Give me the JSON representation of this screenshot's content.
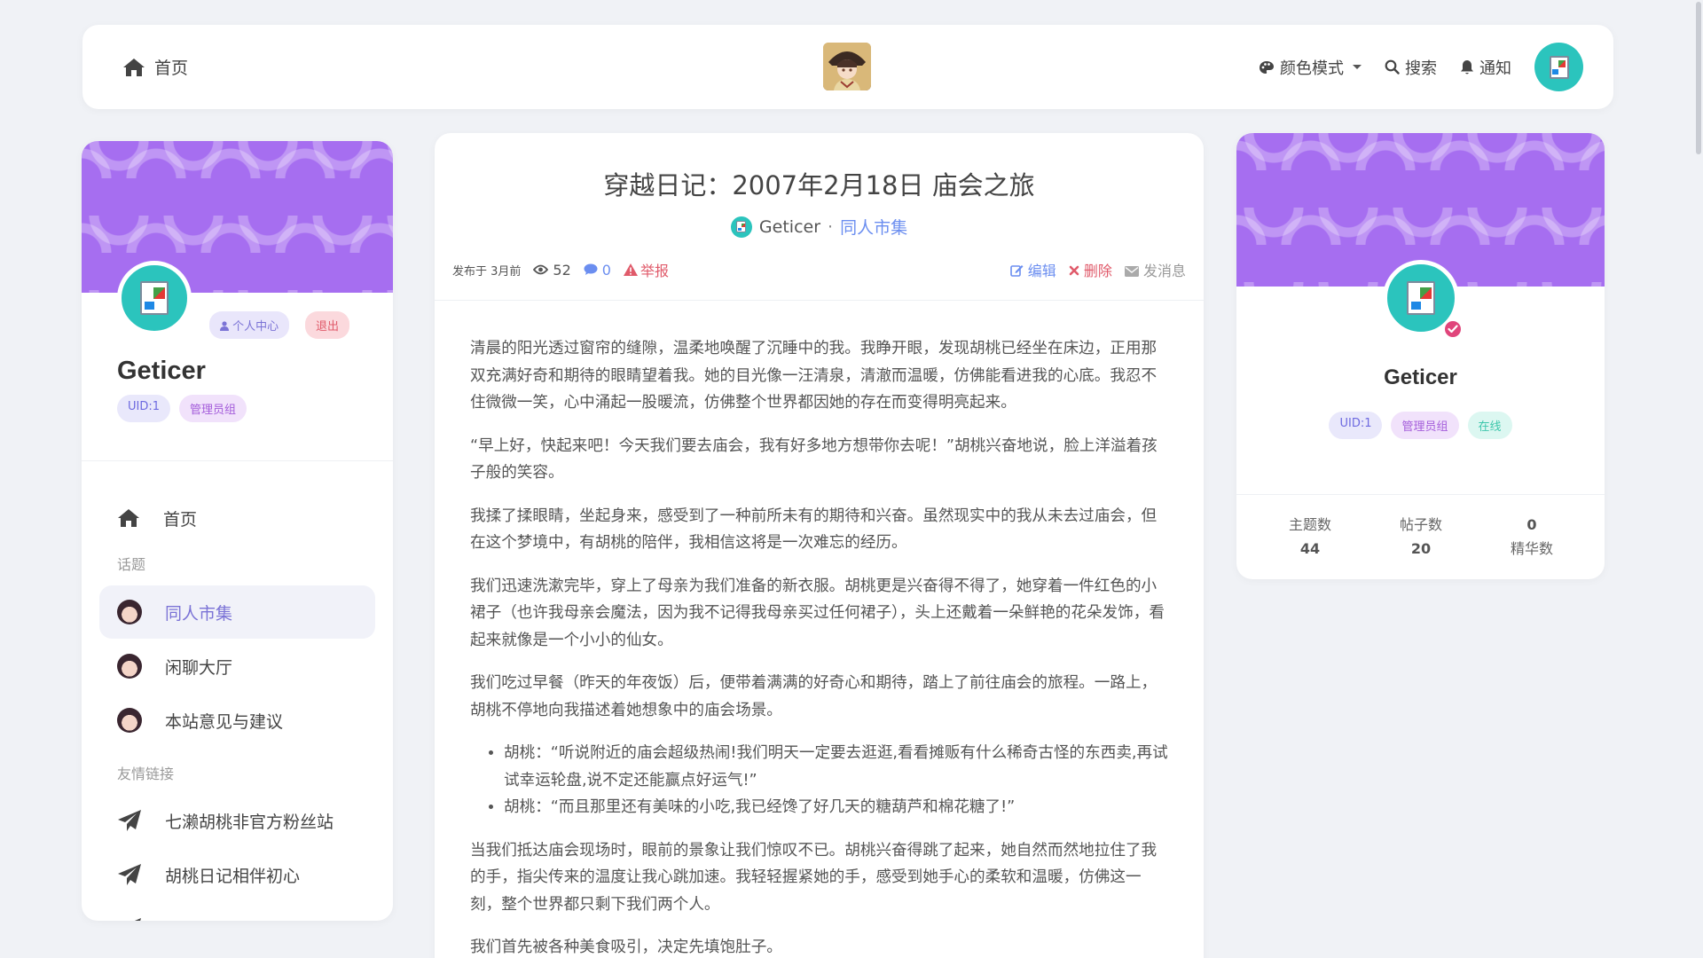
{
  "navbar": {
    "home_label": "首页",
    "color_mode_label": "颜色模式",
    "search_label": "搜索",
    "notify_label": "通知"
  },
  "sidebar": {
    "username": "Geticer",
    "profile_button": "个人中心",
    "logout_button": "退出",
    "uid_tag": "UID:1",
    "role_tag": "管理员组",
    "home_label": "首页",
    "section_topics": "话题",
    "topics": [
      {
        "label": "同人市集",
        "active": true
      },
      {
        "label": "闲聊大厅",
        "active": false
      },
      {
        "label": "本站意见与建议",
        "active": false
      }
    ],
    "section_links": "友情链接",
    "links": [
      {
        "label": "七濑胡桃非官方粉丝站"
      },
      {
        "label": "胡桃日记相伴初心"
      }
    ]
  },
  "post": {
    "title": "穿越日记：2007年2月18日 庙会之旅",
    "author": "Geticer",
    "separator": "·",
    "category": "同人市集",
    "published": "发布于 3月前",
    "views": "52",
    "comments": "0",
    "report": "举报",
    "edit": "编辑",
    "delete": "删除",
    "message": "发消息",
    "paragraphs": [
      "清晨的阳光透过窗帘的缝隙，温柔地唤醒了沉睡中的我。我睁开眼，发现胡桃已经坐在床边，正用那双充满好奇和期待的眼睛望着我。她的目光像一汪清泉，清澈而温暖，仿佛能看进我的心底。我忍不住微微一笑，心中涌起一股暖流，仿佛整个世界都因她的存在而变得明亮起来。",
      "“早上好，快起来吧！今天我们要去庙会，我有好多地方想带你去呢！”胡桃兴奋地说，脸上洋溢着孩子般的笑容。",
      "我揉了揉眼睛，坐起身来，感受到了一种前所未有的期待和兴奋。虽然现实中的我从未去过庙会，但在这个梦境中，有胡桃的陪伴，我相信这将是一次难忘的经历。",
      "我们迅速洗漱完毕，穿上了母亲为我们准备的新衣服。胡桃更是兴奋得不得了，她穿着一件红色的小裙子（也许我母亲会魔法，因为我不记得我母亲买过任何裙子），头上还戴着一朵鲜艳的花朵发饰，看起来就像是一个小小的仙女。",
      "我们吃过早餐（昨天的年夜饭）后，便带着满满的好奇心和期待，踏上了前往庙会的旅程。一路上，胡桃不停地向我描述着她想象中的庙会场景。"
    ],
    "bullets": [
      "胡桃：“听说附近的庙会超级热闹!我们明天一定要去逛逛,看看摊贩有什么稀奇古怪的东西卖,再试试幸运轮盘,说不定还能赢点好运气!”",
      "胡桃：“而且那里还有美味的小吃,我已经馋了好几天的糖葫芦和棉花糖了!”"
    ],
    "paragraphs_after": [
      "当我们抵达庙会现场时，眼前的景象让我们惊叹不已。胡桃兴奋得跳了起来，她自然而然地拉住了我的手，指尖传来的温度让我心跳加速。我轻轻握紧她的手，感受到她手心的柔软和温暖，仿佛这一刻，整个世界都只剩下我们两个人。",
      "我们首先被各种美食吸引，决定先填饱肚子。"
    ]
  },
  "profile_card": {
    "username": "Geticer",
    "uid_tag": "UID:1",
    "role_tag": "管理员组",
    "status_tag": "在线",
    "stats": [
      {
        "label": "主题数",
        "value": "44"
      },
      {
        "label": "帖子数",
        "value": "20"
      },
      {
        "label": "精华数",
        "value": "0"
      }
    ]
  },
  "colors": {
    "accent": "#7b73d6",
    "banner": "#a66ef0",
    "avatar_bg": "#2bc4bd",
    "danger": "#e05a6a",
    "link_blue": "#6b8ef0"
  }
}
